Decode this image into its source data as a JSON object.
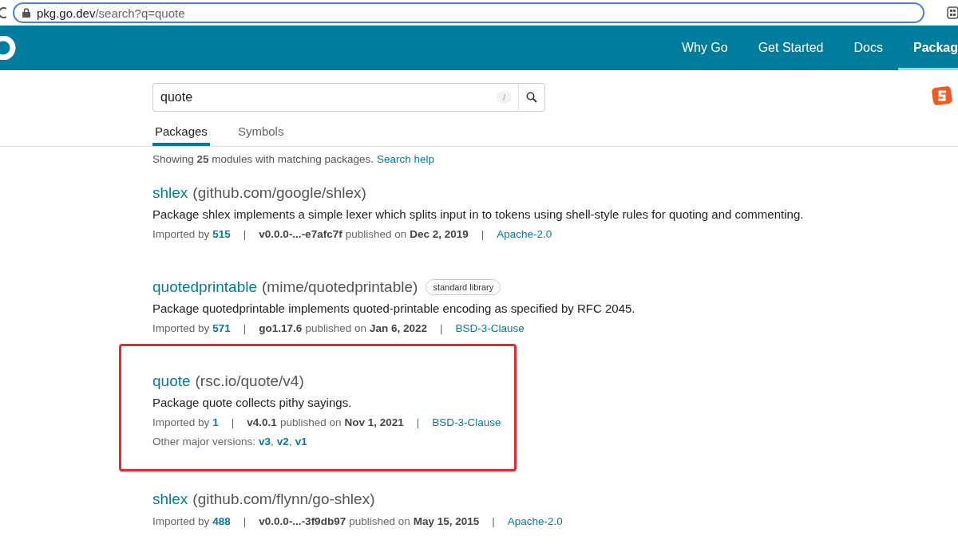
{
  "browser": {
    "url_host": "pkg.go.dev",
    "url_path": "/search?q=quote"
  },
  "nav": [
    {
      "label": "Why Go",
      "selected": false
    },
    {
      "label": "Get Started",
      "selected": false
    },
    {
      "label": "Docs",
      "selected": false
    },
    {
      "label": "Packag",
      "selected": true
    }
  ],
  "search": {
    "value": "quote",
    "shortcut": "/"
  },
  "tabs": [
    {
      "label": "Packages",
      "selected": true
    },
    {
      "label": "Symbols",
      "selected": false
    }
  ],
  "summary": {
    "text": "Showing **25** modules with matching packages.",
    "link": "Search help"
  },
  "meta_separator": "|",
  "results": [
    {
      "name": "shlex",
      "path": "(github.com/google/shlex)",
      "synopsis": "Package shlex implements a simple lexer which splits input in to tokens using shell-style rules for quoting and commenting.",
      "imported_by_label": "Imported by",
      "imported_by": "515",
      "version": "v0.0.0-...-e7afc7f",
      "published_label": "published on",
      "date": "Dec 2, 2019",
      "license": "Apache-2.0",
      "highlighted": false
    },
    {
      "name": "quotedprintable",
      "path": "(mime/quotedprintable)",
      "badge": "standard library",
      "synopsis": "Package quotedprintable implements quoted-printable encoding as specified by RFC 2045.",
      "imported_by_label": "Imported by",
      "imported_by": "571",
      "version": "go1.17.6",
      "published_label": "published on",
      "date": "Jan 6, 2022",
      "license": "BSD-3-Clause",
      "highlighted": false
    },
    {
      "name": "quote",
      "path": "(rsc.io/quote/v4)",
      "synopsis": "Package quote collects pithy sayings.",
      "imported_by_label": "Imported by",
      "imported_by": "1",
      "version": "v4.0.1",
      "published_label": "published on",
      "date": "Nov 1, 2021",
      "license": "BSD-3-Clause",
      "other_versions": {
        "label": "Other major versions:",
        "links": [
          "v3",
          "v2",
          "v1"
        ],
        "comma": ","
      },
      "highlighted": true
    },
    {
      "name": "shlex",
      "path": "(github.com/flynn/go-shlex)",
      "imported_by_label": "Imported by",
      "imported_by": "488",
      "version": "v0.0.0-...-3f9db97",
      "published_label": "published on",
      "date": "May 15, 2015",
      "license": "Apache-2.0",
      "highlighted": false
    }
  ]
}
